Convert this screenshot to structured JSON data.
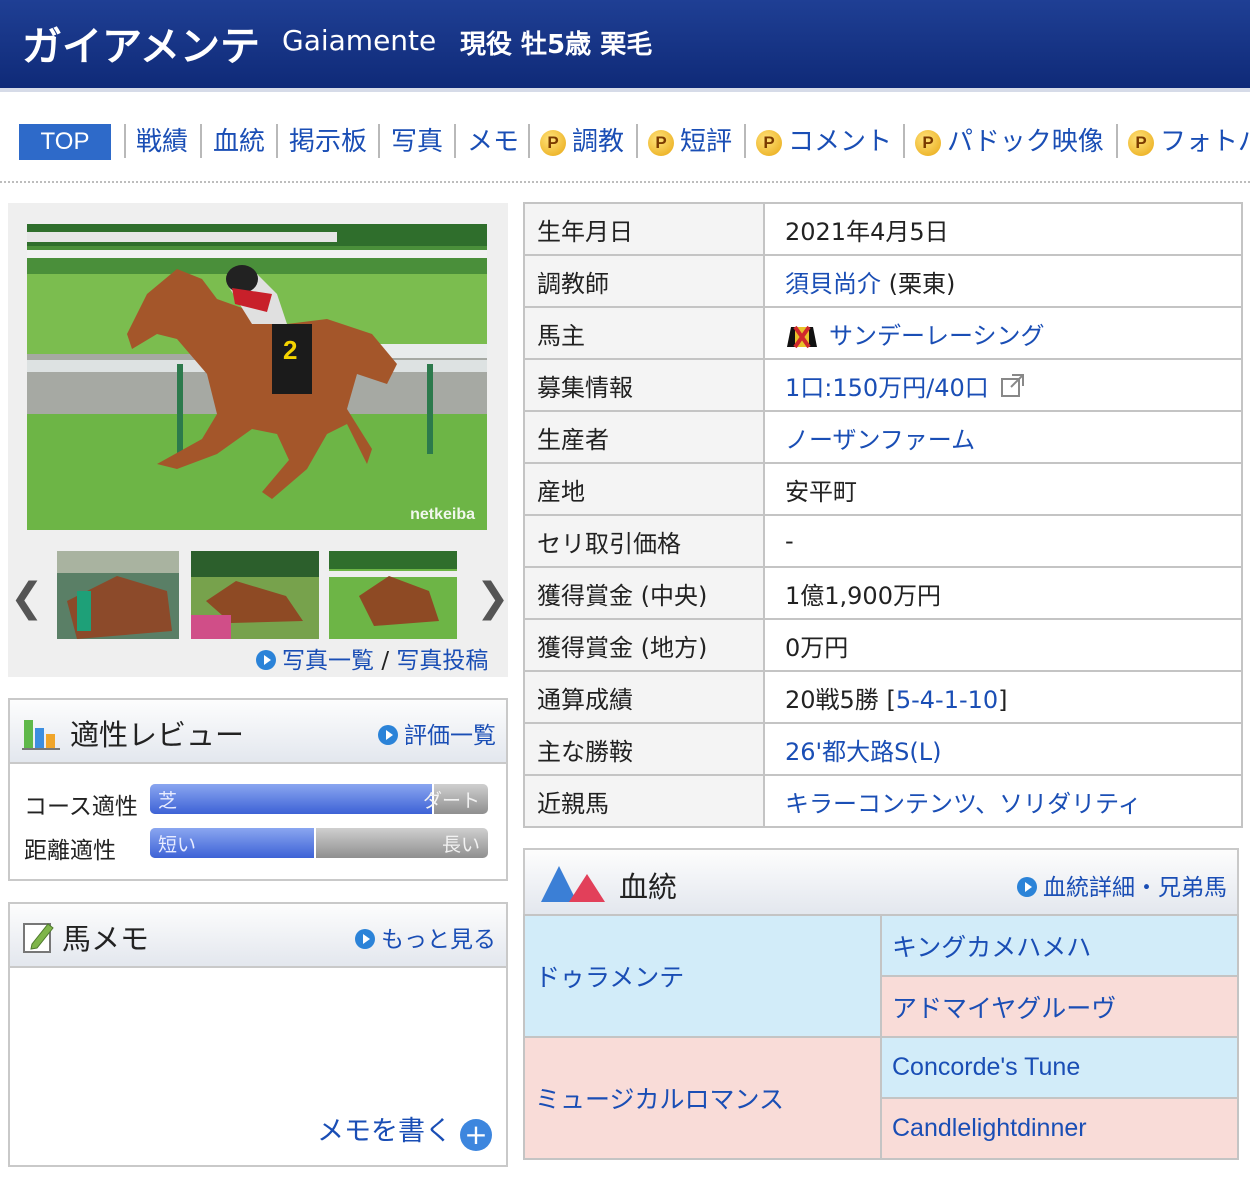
{
  "header": {
    "horse_name": "ガイアメンテ",
    "english_name": "Gaiamente",
    "status": "現役 牡5歳 栗毛"
  },
  "nav": {
    "top": "TOP",
    "items": [
      "戦績",
      "血統",
      "掲示板",
      "写真",
      "メモ",
      "調教",
      "短評",
      "コメント",
      "パドック映像",
      "フォトパ"
    ],
    "premium_badge": "P"
  },
  "photo": {
    "watermark": "netkeiba",
    "list_link": "写真一覧",
    "separator": "/",
    "post_link": "写真投稿"
  },
  "aptitude": {
    "title": "適性レビュー",
    "link": "評価一覧",
    "course_label": "コース適性",
    "course_left": "芝",
    "course_right": "ダート",
    "course_value": 0.84,
    "distance_label": "距離適性",
    "distance_left": "短い",
    "distance_right": "長い",
    "distance_value": 0.49
  },
  "memo": {
    "title": "馬メモ",
    "link": "もっと見る",
    "write": "メモを書く",
    "plus": "+"
  },
  "profile": {
    "birth_label": "生年月日",
    "birth": "2021年4月5日",
    "trainer_label": "調教師",
    "trainer": "須貝尚介",
    "trainer_stable": "(栗東)",
    "owner_label": "馬主",
    "owner": "サンデーレーシング",
    "offer_label": "募集情報",
    "offer": "1口:150万円/40口",
    "breeder_label": "生産者",
    "breeder": "ノーザンファーム",
    "origin_label": "産地",
    "origin": "安平町",
    "auction_label": "セリ取引価格",
    "auction": "-",
    "prize_central_label": "獲得賞金 (中央)",
    "prize_central": "1億1,900万円",
    "prize_local_label": "獲得賞金 (地方)",
    "prize_local": "0万円",
    "record_label": "通算成績",
    "record": "20戦5勝",
    "record_open": "[",
    "record_detail": "5-4-1-10",
    "record_close": "]",
    "major_win_label": "主な勝鞍",
    "major_win": "26'都大路S(L)",
    "relatives_label": "近親馬",
    "relatives": "キラーコンテンツ、ソリダリティ"
  },
  "pedigree": {
    "title": "血統",
    "link": "血統詳細・兄弟馬",
    "sire": "ドゥラメンテ",
    "dam": "ミュージカルロマンス",
    "sire_sire": "キングカメハメハ",
    "sire_dam": "アドマイヤグルーヴ",
    "dam_sire": "Concorde's Tune",
    "dam_dam": "Candlelightdinner"
  },
  "colors": {
    "header_bg": "#1f3f94",
    "link": "#1a4eb5",
    "pedigree_male": "#d2ecf9",
    "pedigree_female": "#f9dcd8"
  }
}
